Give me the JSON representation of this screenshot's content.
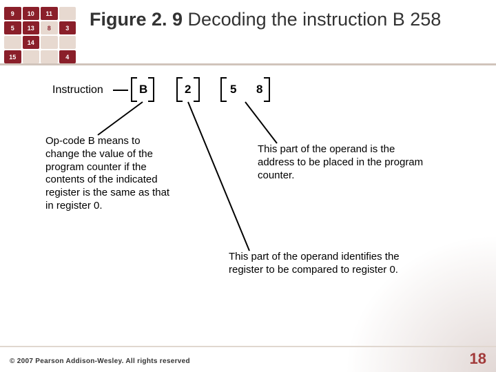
{
  "header": {
    "figure_label": "Figure 2. 9",
    "title_rest": "  Decoding the instruction B 258"
  },
  "diagram": {
    "instruction_label": "Instruction",
    "cells": {
      "b": "B",
      "d2": "2",
      "d5": "5",
      "d8": "8"
    },
    "para_opcode": "Op-code B means to change  the value of the program counter if the contents of the indicated register is the same as that in register 0.",
    "para_address": "This part of the operand is the address to be placed in the program counter.",
    "para_register": "This part of the operand identifies the register to be compared to register 0."
  },
  "thumb_cells": [
    "9",
    "10",
    "11",
    "",
    "5",
    "13",
    "",
    "3",
    "",
    "14",
    "",
    "",
    "15",
    "",
    "",
    "4"
  ],
  "footer": {
    "copyright": "© 2007 Pearson Addison-Wesley. All rights reserved",
    "page": "18"
  }
}
